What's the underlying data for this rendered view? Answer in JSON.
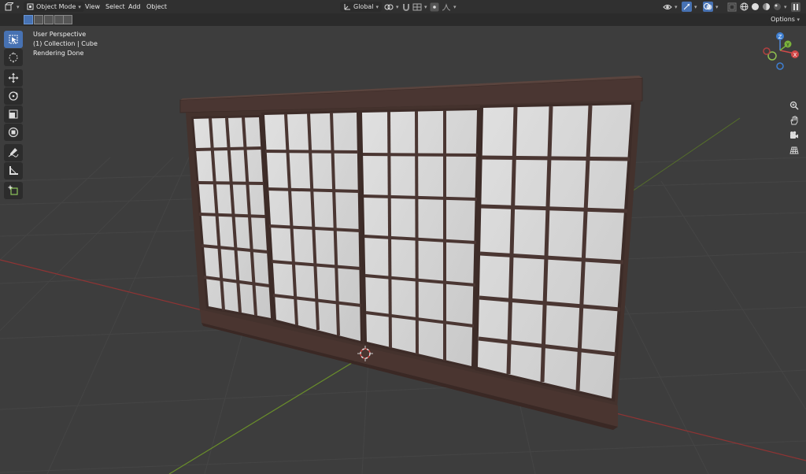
{
  "header": {
    "editor_type_icon": "3d-viewport-icon",
    "mode": "Object Mode",
    "menus": [
      "View",
      "Select",
      "Add",
      "Object"
    ],
    "orientation": "Global",
    "options_label": "Options"
  },
  "overlay": {
    "view_name": "User Perspective",
    "collection": "(1) Collection | Cube",
    "status": "Rendering Done"
  },
  "toolbar": {
    "tools": [
      "select-box-icon",
      "cursor-icon",
      "move-icon",
      "rotate-icon",
      "scale-icon",
      "transform-icon",
      "annotate-icon",
      "measure-icon",
      "add-cube-icon"
    ]
  },
  "navigation": {
    "gizmo_axes": [
      "Z",
      "Y",
      "X"
    ],
    "buttons": [
      "zoom-icon",
      "pan-hand-icon",
      "camera-icon",
      "grid-perspective-icon"
    ]
  },
  "colors": {
    "viewport_bg": "#3d3d3d",
    "header_bg": "#303030",
    "active_tool": "#4772b3",
    "x_axis": "#a03a3a",
    "y_axis": "#6a8f2a",
    "frame_wood": "#4a3530",
    "paper": "#d8d8d8"
  }
}
